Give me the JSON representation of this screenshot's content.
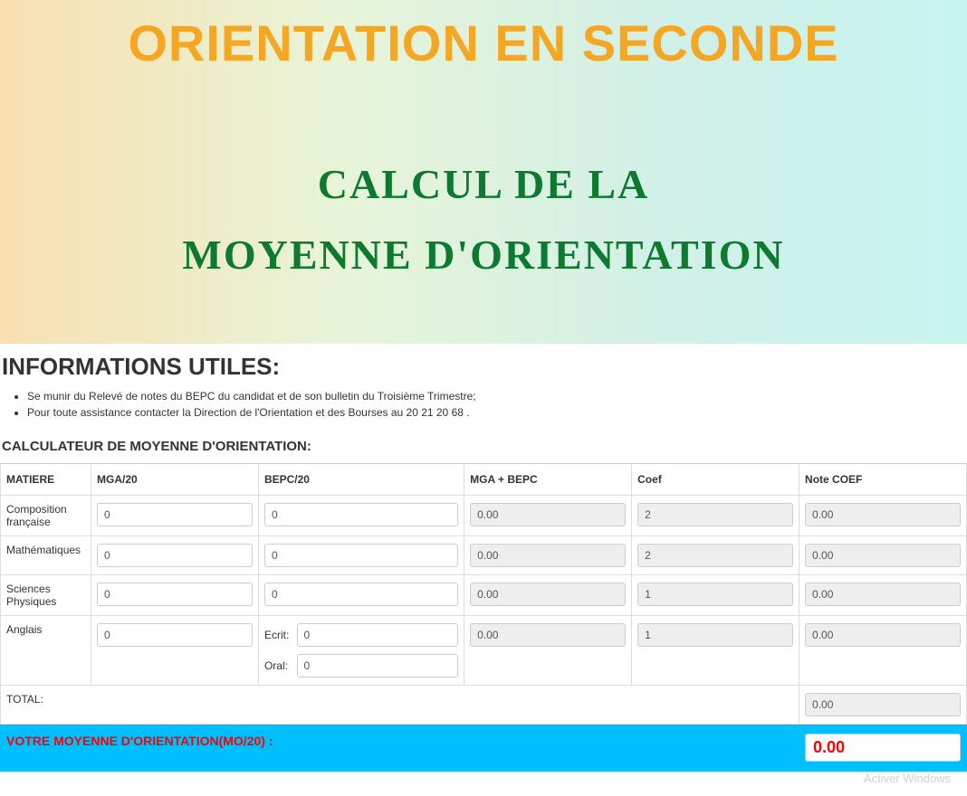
{
  "banner": {
    "title": "ORIENTATION EN SECONDE",
    "subtitle_line1": "CALCUL DE LA",
    "subtitle_line2": "MOYENNE D'ORIENTATION"
  },
  "info": {
    "heading": "INFORMATIONS UTILES:",
    "items": [
      "Se munir du Relevé de notes du BEPC du candidat et de son bulletin du Troisième Trimestre;",
      "Pour toute assistance contacter la Direction de l'Orientation et des Bourses au 20 21 20 68 ."
    ]
  },
  "calc": {
    "heading": "CALCULATEUR DE MOYENNE D'ORIENTATION:",
    "columns": {
      "matiere": "MATIERE",
      "mga": "MGA/20",
      "bepc": "BEPC/20",
      "sum": "MGA + BEPC",
      "coef": "Coef",
      "note": "Note COEF"
    },
    "rows": [
      {
        "matiere": "Composition française",
        "mga": "0",
        "bepc": "0",
        "sum": "0.00",
        "coef": "2",
        "note": "0.00"
      },
      {
        "matiere": "Mathématiques",
        "mga": "0",
        "bepc": "0",
        "sum": "0.00",
        "coef": "2",
        "note": "0.00"
      },
      {
        "matiere": "Sciences Physiques",
        "mga": "0",
        "bepc": "0",
        "sum": "0.00",
        "coef": "1",
        "note": "0.00"
      }
    ],
    "anglais": {
      "matiere": "Anglais",
      "mga": "0",
      "ecrit_label": "Ecrit:",
      "ecrit": "0",
      "oral_label": "Oral:",
      "oral": "0",
      "sum": "0.00",
      "coef": "1",
      "note": "0.00"
    },
    "total": {
      "label": "TOTAL:",
      "value": "0.00"
    },
    "result": {
      "label": "VOTRE MOYENNE D'ORIENTATION(MO/20) :",
      "value": "0.00"
    }
  },
  "watermark": "Activer Windows"
}
